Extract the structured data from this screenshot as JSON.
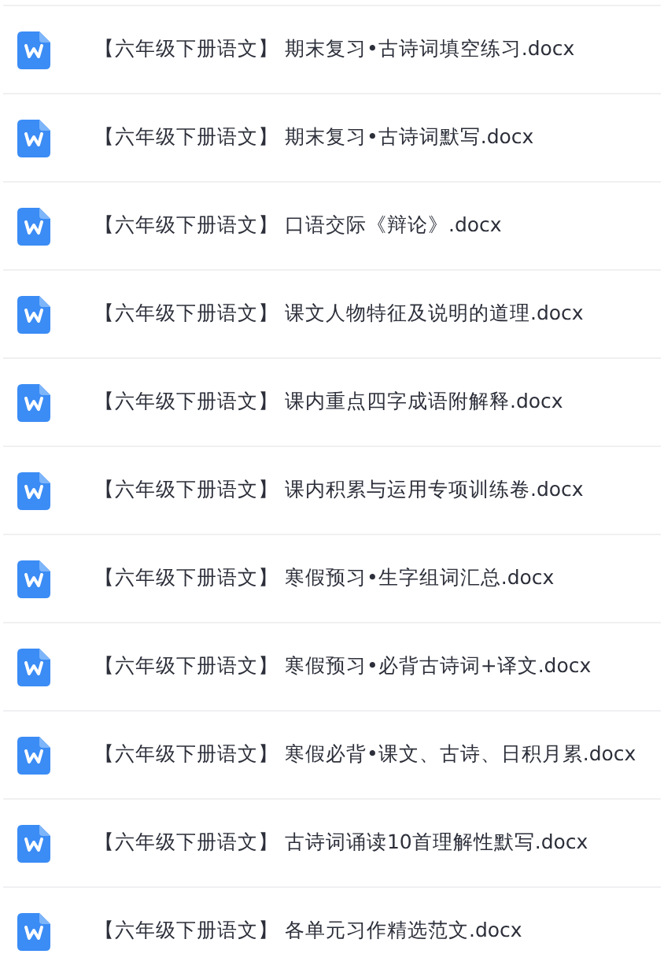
{
  "files": [
    {
      "name": "【六年级下册语文】 期末复习•古诗词填空练习.docx"
    },
    {
      "name": "【六年级下册语文】 期末复习•古诗词默写.docx"
    },
    {
      "name": "【六年级下册语文】 口语交际《辩论》.docx"
    },
    {
      "name": "【六年级下册语文】 课文人物特征及说明的道理.docx"
    },
    {
      "name": "【六年级下册语文】 课内重点四字成语附解释.docx"
    },
    {
      "name": "【六年级下册语文】 课内积累与运用专项训练卷.docx"
    },
    {
      "name": "【六年级下册语文】 寒假预习•生字组词汇总.docx"
    },
    {
      "name": "【六年级下册语文】 寒假预习•必背古诗词+译文.docx"
    },
    {
      "name": "【六年级下册语文】 寒假必背•课文、古诗、日积月累.docx"
    },
    {
      "name": "【六年级下册语文】 古诗词诵读10首理解性默写.docx"
    },
    {
      "name": "【六年级下册语文】 各单元习作精选范文.docx"
    }
  ]
}
